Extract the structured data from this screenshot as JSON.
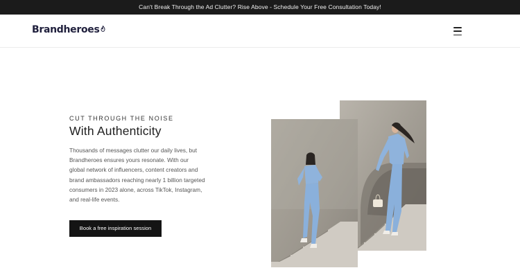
{
  "announcement": {
    "text": "Can't Break Through the Ad Clutter? Rise Above - Schedule Your Free Consultation Today!"
  },
  "header": {
    "logo_text": "Brandheroes",
    "menu_icon": "hamburger-menu-icon"
  },
  "hero": {
    "eyebrow": "CUT THROUGH THE NOISE",
    "headline": "With Authenticity",
    "body": "Thousands of messages clutter our daily lives, but Brandheroes ensures yours resonate. With our global network of influencers, content creators and brand ambassadors reaching nearly 1 billion targeted consumers in 2023 alone, across TikTok, Instagram, and real-life events.",
    "cta_label": "Book a free inspiration session"
  },
  "colors": {
    "announcement_bg": "#1b1b1b",
    "brand_navy": "#1f1f3c",
    "cta_bg": "#141414",
    "outfit_blue": "#8fb3dc",
    "concrete": "#a8a39b"
  }
}
